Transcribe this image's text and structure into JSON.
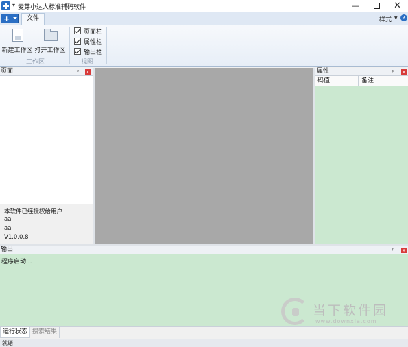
{
  "window": {
    "title": "麦芽小达人标准辅码软件",
    "pin_glyph": "📌",
    "minimize": "—",
    "close": "✕"
  },
  "tabs": {
    "file": "文件",
    "style_label": "样式",
    "style_arrow": "▼",
    "help": "?"
  },
  "ribbon": {
    "workspace_group": {
      "label": "工作区",
      "new_workspace": "新建工作区",
      "open_workspace": "打开工作区"
    },
    "view_group": {
      "label": "视图",
      "checkboxes": [
        {
          "label": "页面栏",
          "checked": true
        },
        {
          "label": "属性栏",
          "checked": true
        },
        {
          "label": "输出栏",
          "checked": true
        }
      ]
    }
  },
  "pages_panel": {
    "title": "页面",
    "pin": "ᵖ",
    "close": "x",
    "info": [
      "本软件已经授权给用户",
      "aa",
      "aa",
      "V1.0.0.8"
    ]
  },
  "properties_panel": {
    "title": "属性",
    "pin": "ᵖ",
    "close": "x",
    "columns": [
      "码值",
      "备注"
    ]
  },
  "output_panel": {
    "title": "输出",
    "pin": "ᵖ",
    "close": "x",
    "log": "程序启动..."
  },
  "bottom_tabs": [
    "运行状态",
    "搜索结果"
  ],
  "status": "就绪",
  "watermark": {
    "main": "当下软件园",
    "sub": "www.downxia.com"
  },
  "colors": {
    "panel_green": "#cbe8d0",
    "canvas_gray": "#a8a8a8",
    "accent_blue": "#2b6fc4"
  }
}
